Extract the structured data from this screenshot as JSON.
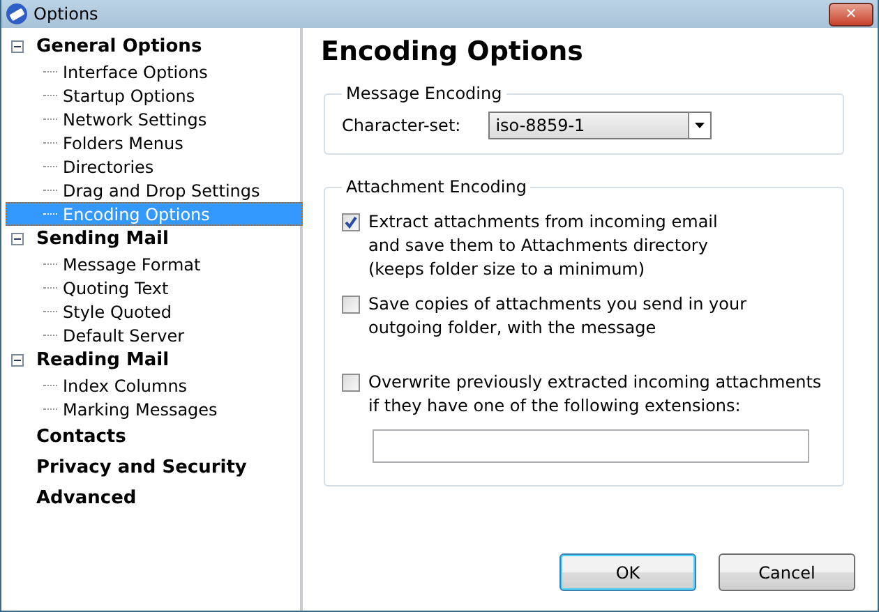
{
  "window": {
    "title": "Options",
    "close": "✕"
  },
  "tree": [
    {
      "label": "General Options",
      "expanded": true,
      "children": [
        {
          "label": "Interface Options",
          "selected": false
        },
        {
          "label": "Startup Options",
          "selected": false
        },
        {
          "label": "Network Settings",
          "selected": false
        },
        {
          "label": "Folders Menus",
          "selected": false
        },
        {
          "label": "Directories",
          "selected": false
        },
        {
          "label": "Drag and Drop Settings",
          "selected": false
        },
        {
          "label": "Encoding Options",
          "selected": true
        }
      ]
    },
    {
      "label": "Sending Mail",
      "expanded": true,
      "children": [
        {
          "label": "Message Format",
          "selected": false
        },
        {
          "label": "Quoting Text",
          "selected": false
        },
        {
          "label": "Style Quoted",
          "selected": false
        },
        {
          "label": "Default Server",
          "selected": false
        }
      ]
    },
    {
      "label": "Reading Mail",
      "expanded": true,
      "children": [
        {
          "label": "Index Columns",
          "selected": false
        },
        {
          "label": "Marking Messages",
          "selected": false
        }
      ]
    },
    {
      "label": "Contacts"
    },
    {
      "label": "Privacy and Security"
    },
    {
      "label": "Advanced"
    }
  ],
  "panel": {
    "title": "Encoding Options",
    "message_encoding": {
      "legend": "Message Encoding",
      "label": "Character-set:",
      "value": "iso-8859-1"
    },
    "attachment_encoding": {
      "legend": "Attachment Encoding",
      "options": [
        {
          "label": "Extract attachments from incoming email\nand save them to Attachments directory\n(keeps folder size to a minimum)",
          "checked": true
        },
        {
          "label": "Save copies of attachments you send in your\noutgoing folder, with the message",
          "checked": false
        },
        {
          "label": "Overwrite previously extracted incoming attachments\nif they have one of the following extensions:",
          "checked": false
        }
      ]
    }
  },
  "buttons": [
    {
      "label": "OK",
      "default": true
    },
    {
      "label": "Cancel",
      "default": false
    }
  ]
}
